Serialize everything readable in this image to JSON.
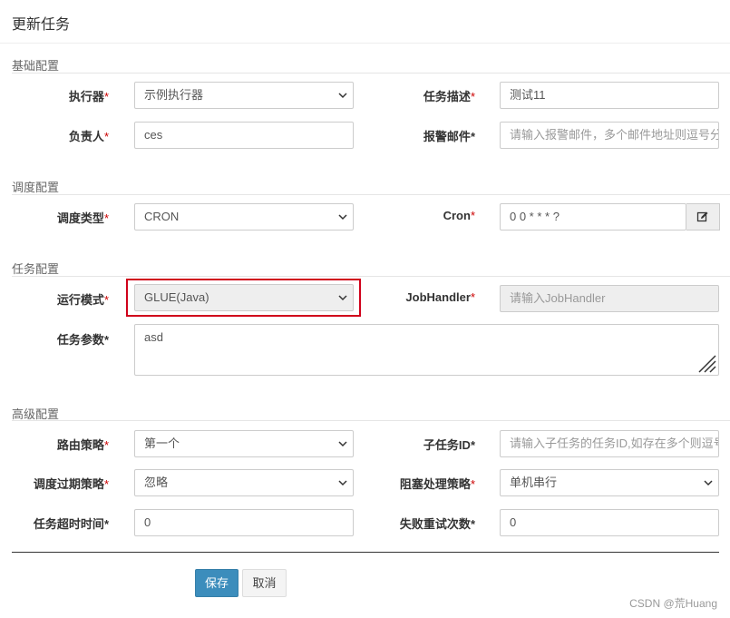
{
  "dialog": {
    "title": "更新任务"
  },
  "sections": {
    "basic": "基础配置",
    "schedule": "调度配置",
    "task": "任务配置",
    "advanced": "高级配置"
  },
  "fields": {
    "executor": {
      "label": "执行器",
      "value": "示例执行器"
    },
    "job_desc": {
      "label": "任务描述",
      "value": "测试11"
    },
    "author": {
      "label": "负责人",
      "value": "ces"
    },
    "alarm_email": {
      "label": "报警邮件",
      "placeholder": "请输入报警邮件，多个邮件地址则逗号分隔"
    },
    "schedule_type": {
      "label": "调度类型",
      "value": "CRON"
    },
    "cron": {
      "label": "Cron",
      "value": "0 0 * * * ?"
    },
    "run_mode": {
      "label": "运行模式",
      "value": "GLUE(Java)"
    },
    "job_handler": {
      "label": "JobHandler",
      "placeholder": "请输入JobHandler"
    },
    "job_param": {
      "label": "任务参数",
      "value": "asd"
    },
    "route_strategy": {
      "label": "路由策略",
      "value": "第一个"
    },
    "child_job_id": {
      "label": "子任务ID",
      "placeholder": "请输入子任务的任务ID,如存在多个则逗号分隔"
    },
    "misfire_strategy": {
      "label": "调度过期策略",
      "value": "忽略"
    },
    "block_strategy": {
      "label": "阻塞处理策略",
      "value": "单机串行"
    },
    "timeout": {
      "label": "任务超时时间",
      "value": "0"
    },
    "fail_retry": {
      "label": "失败重试次数",
      "value": "0"
    }
  },
  "buttons": {
    "save": "保存",
    "cancel": "取消"
  },
  "watermark": "CSDN @荒Huang",
  "colors": {
    "primary": "#3c8dbc",
    "required": "#cc0000",
    "highlight": "#d0021b"
  },
  "icons": {
    "select_arrow": "chevron-down-icon",
    "cron_edit": "edit-icon",
    "resize": "resize-grip-icon"
  }
}
